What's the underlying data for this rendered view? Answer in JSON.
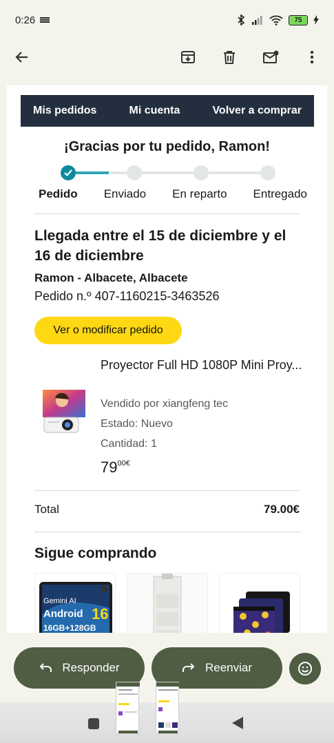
{
  "status_bar": {
    "time": "0:26",
    "battery": "75"
  },
  "toolbar": {
    "back_icon": "arrow-left-icon",
    "icons": [
      "archive-icon",
      "trash-icon",
      "mark-unread-icon",
      "more-vert-icon"
    ]
  },
  "email": {
    "nav": {
      "orders": "Mis pedidos",
      "account": "Mi cuenta",
      "buy_again": "Volver a comprar"
    },
    "thanks": "¡Gracias por tu pedido, Ramon!",
    "steps": [
      "Pedido",
      "Enviado",
      "En reparto",
      "Entregado"
    ],
    "arrival": "Llegada entre el 15 de diciembre y el 16 de diciembre",
    "address": "Ramon - Albacete, Albacete",
    "order_number": "Pedido n.º 407-1160215-3463526",
    "view_button": "Ver o modificar pedido",
    "product": {
      "title": "Proyector Full HD 1080P Mini Proy...",
      "seller": "Vendido por xiangfeng tec",
      "condition": "Estado: Nuevo",
      "quantity": "Cantidad: 1",
      "price_whole": "79",
      "price_fraction": "00€"
    },
    "total_label": "Total",
    "total_value": "79.00€",
    "keep_shopping": "Sigue comprando",
    "recommendations": {
      "tablet_line1": "Gemini AI",
      "tablet_os": "Android",
      "tablet_version": "16",
      "tablet_storage": "16GB+128GB"
    }
  },
  "actions": {
    "reply": "Responder",
    "forward": "Reenviar"
  },
  "colors": {
    "amazon_nav": "#232f3e",
    "cta_yellow": "#ffd814",
    "progress_teal": "#0f8a9b",
    "gmail_button": "#4f5d43"
  }
}
